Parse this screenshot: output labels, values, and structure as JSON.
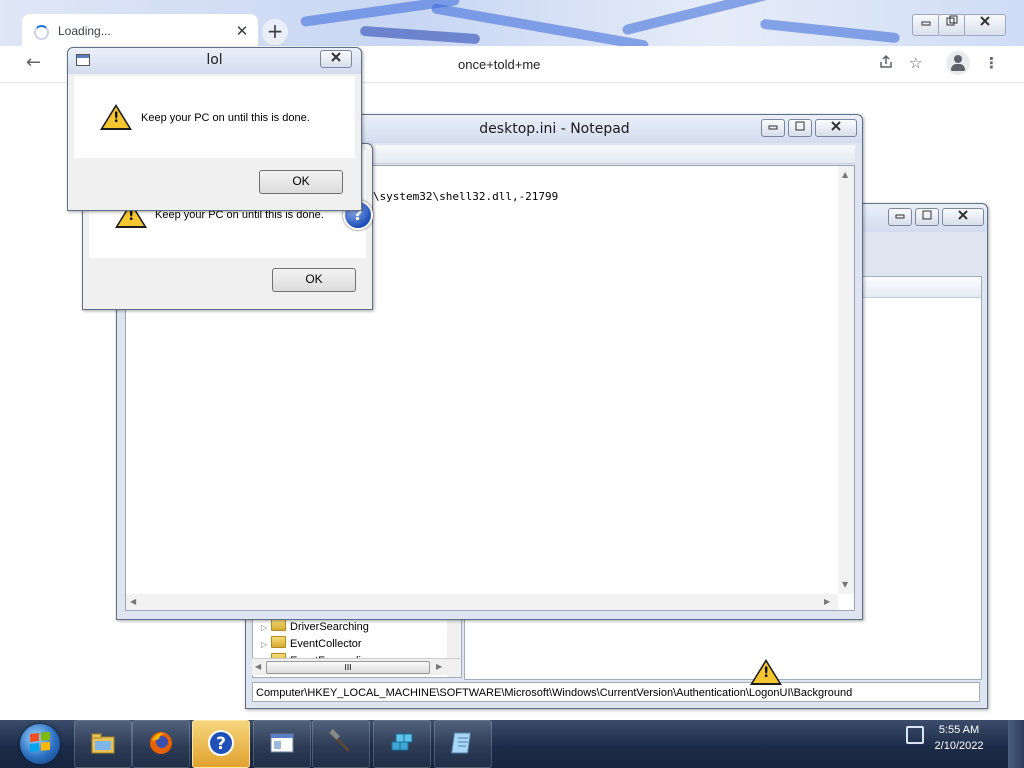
{
  "browser": {
    "tab_title": "Loading...",
    "tab_close": "✕",
    "new_tab": "+",
    "omnibox_text": "once+told+me",
    "window_controls": [
      "minimize",
      "restore",
      "close"
    ]
  },
  "notepad": {
    "title": "desktop.ini - Notepad",
    "content": "ot%\\system32\\shell32.dll,-21799"
  },
  "regedit": {
    "tree_items": [
      {
        "label": "DriverSearching"
      },
      {
        "label": "EventCollector"
      },
      {
        "label": "EventForwarding"
      }
    ],
    "status_path": "Computer\\HKEY_LOCAL_MACHINE\\SOFTWARE\\Microsoft\\Windows\\CurrentVersion\\Authentication\\LogonUI\\Background",
    "scroll_thumb": "III"
  },
  "dialog_front": {
    "title": "lol",
    "message": "Keep your PC on until this is done.",
    "ok_label": "OK"
  },
  "dialog_back": {
    "message": "Keep your PC on until this is done.",
    "ok_label": "OK"
  },
  "help_badge": "?",
  "taskbar": {
    "apps": [
      {
        "name": "windows-explorer"
      },
      {
        "name": "firefox"
      },
      {
        "name": "help-and-support",
        "active": true
      },
      {
        "name": "window-app"
      },
      {
        "name": "tool-app"
      },
      {
        "name": "blocks-app"
      },
      {
        "name": "notepad-app"
      }
    ],
    "clock_time": "5:55 AM",
    "clock_date": "2/10/2022"
  },
  "colors": {
    "taskbar": "#1d2c48",
    "warning": "#f6c631",
    "help_blue": "#1f4fb8"
  }
}
